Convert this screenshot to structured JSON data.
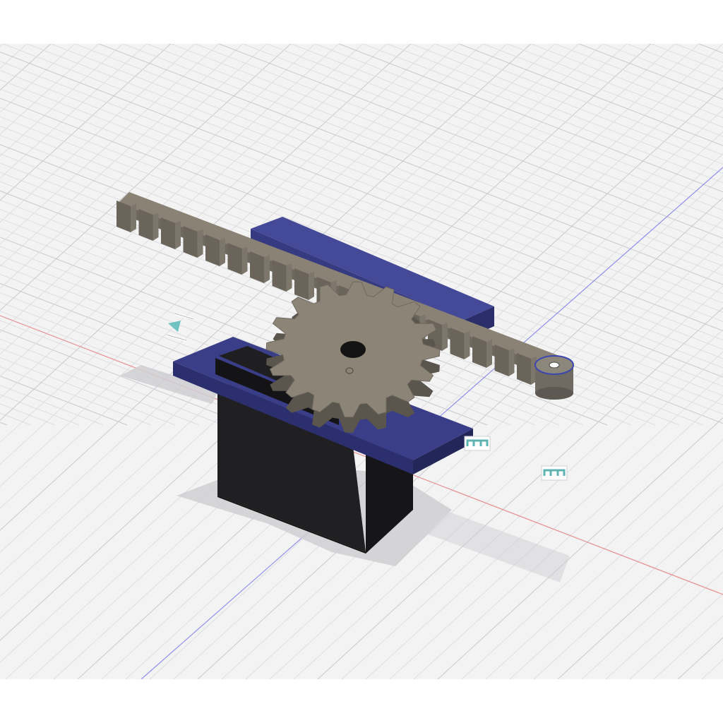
{
  "app": {
    "description_hidden": ""
  },
  "viewport": {
    "background": "#f3f3f4",
    "grid_color": "#d6d6da",
    "grid_major_color": "#c4c4c9",
    "x_axis_color": "#e06a6a",
    "y_axis_color": "#6a6ae6"
  },
  "model": {
    "rack_color": "#8a8275",
    "gear_color": "#8c8577",
    "bracket_color": "#3b3f86",
    "servo_color": "#1c1c1e"
  },
  "constraint_glyphs": [
    {
      "icon": "parallel-constraint-icon"
    },
    {
      "icon": "coincident-constraint-icon"
    },
    {
      "icon": "coincident-constraint-icon"
    }
  ]
}
